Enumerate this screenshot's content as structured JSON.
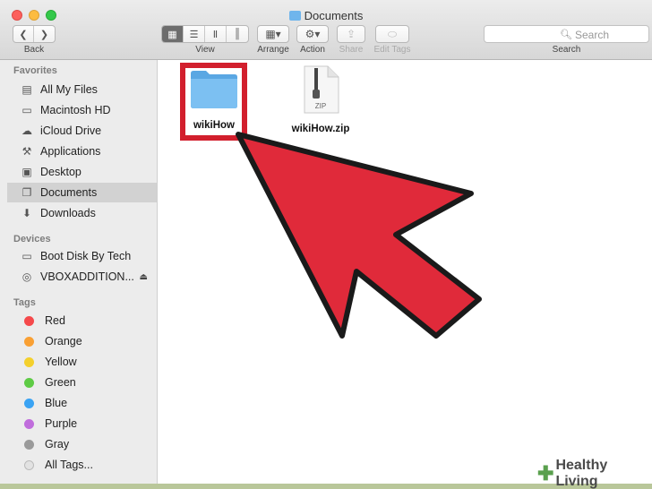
{
  "window": {
    "title": "Documents"
  },
  "toolbar": {
    "back_label": "Back",
    "view_label": "View",
    "arrange_label": "Arrange",
    "action_label": "Action",
    "share_label": "Share",
    "edit_tags_label": "Edit Tags",
    "search_placeholder": "Search",
    "search_label": "Search"
  },
  "sidebar": {
    "favorites_heading": "Favorites",
    "favorites": [
      {
        "label": "All My Files",
        "icon": "all-files-icon"
      },
      {
        "label": "Macintosh HD",
        "icon": "hard-drive-icon"
      },
      {
        "label": "iCloud Drive",
        "icon": "cloud-icon"
      },
      {
        "label": "Applications",
        "icon": "applications-icon"
      },
      {
        "label": "Desktop",
        "icon": "desktop-icon"
      },
      {
        "label": "Documents",
        "icon": "documents-icon",
        "selected": true
      },
      {
        "label": "Downloads",
        "icon": "downloads-icon"
      }
    ],
    "devices_heading": "Devices",
    "devices": [
      {
        "label": "Boot Disk By Tech",
        "icon": "disk-icon"
      },
      {
        "label": "VBOXADDITION...",
        "icon": "optical-disc-icon",
        "eject": true
      }
    ],
    "tags_heading": "Tags",
    "tags": [
      {
        "label": "Red",
        "color": "#f5494b"
      },
      {
        "label": "Orange",
        "color": "#f9a033"
      },
      {
        "label": "Yellow",
        "color": "#f4d02c"
      },
      {
        "label": "Green",
        "color": "#5ecb45"
      },
      {
        "label": "Blue",
        "color": "#3aa3f3"
      },
      {
        "label": "Purple",
        "color": "#c06ddc"
      },
      {
        "label": "Gray",
        "color": "#9a9a9a"
      },
      {
        "label": "All Tags...",
        "color": "#e2e2e2"
      }
    ]
  },
  "files": [
    {
      "name": "wikiHow",
      "kind": "folder"
    },
    {
      "name": "wikiHow.zip",
      "kind": "zip",
      "badge": "ZIP"
    }
  ],
  "watermark": {
    "text": "Healthy Living"
  },
  "colors": {
    "highlight": "#d21f2d",
    "arrow": "#e02a3a",
    "folder": "#6fb5ec"
  }
}
